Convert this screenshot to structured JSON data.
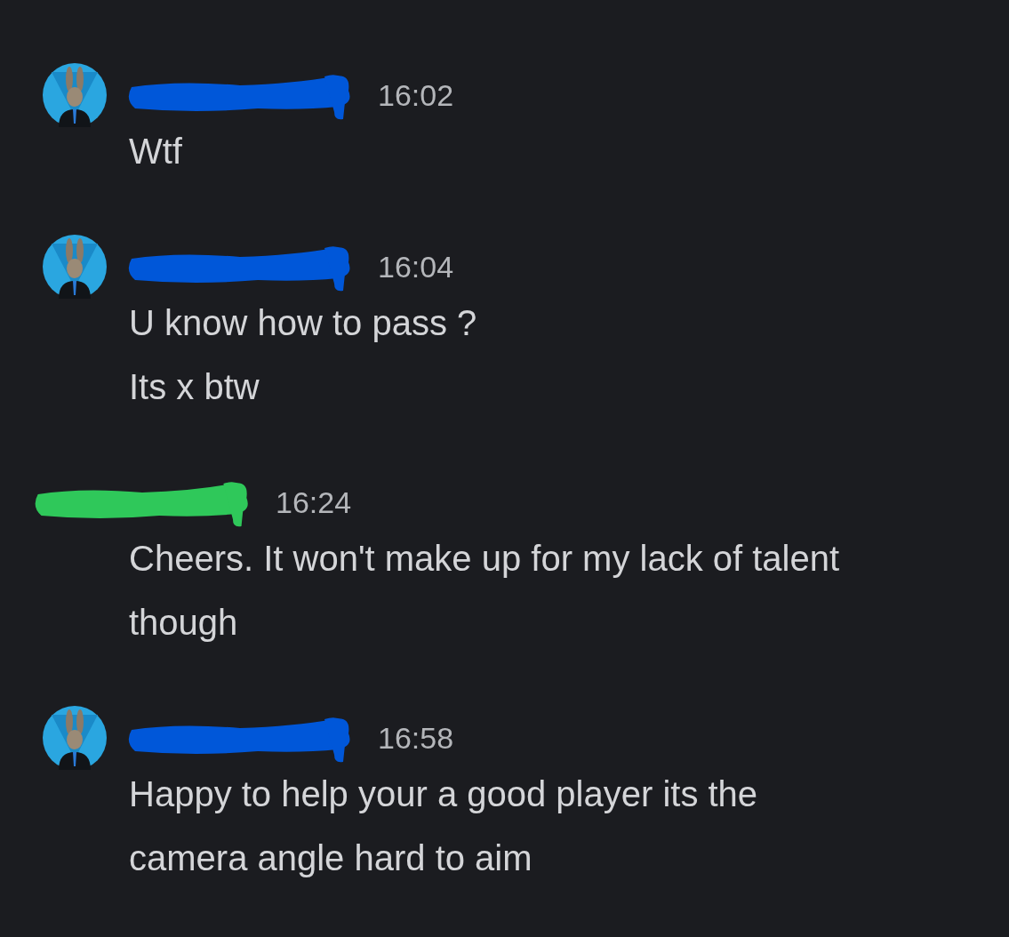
{
  "messages": [
    {
      "avatar": true,
      "color": "#0057d9",
      "time": "16:02",
      "lines": [
        "Wtf"
      ]
    },
    {
      "avatar": true,
      "color": "#0057d9",
      "time": "16:04",
      "lines": [
        "U know how to pass ?",
        "Its x btw"
      ]
    },
    {
      "avatar": false,
      "color": "#2fc85a",
      "time": "16:24",
      "lines": [
        "Cheers. It won't make up for my lack of talent",
        "though"
      ]
    },
    {
      "avatar": true,
      "color": "#0057d9",
      "time": "16:58",
      "lines": [
        "Happy to help your a good player its the",
        "camera angle hard to aim"
      ]
    }
  ]
}
